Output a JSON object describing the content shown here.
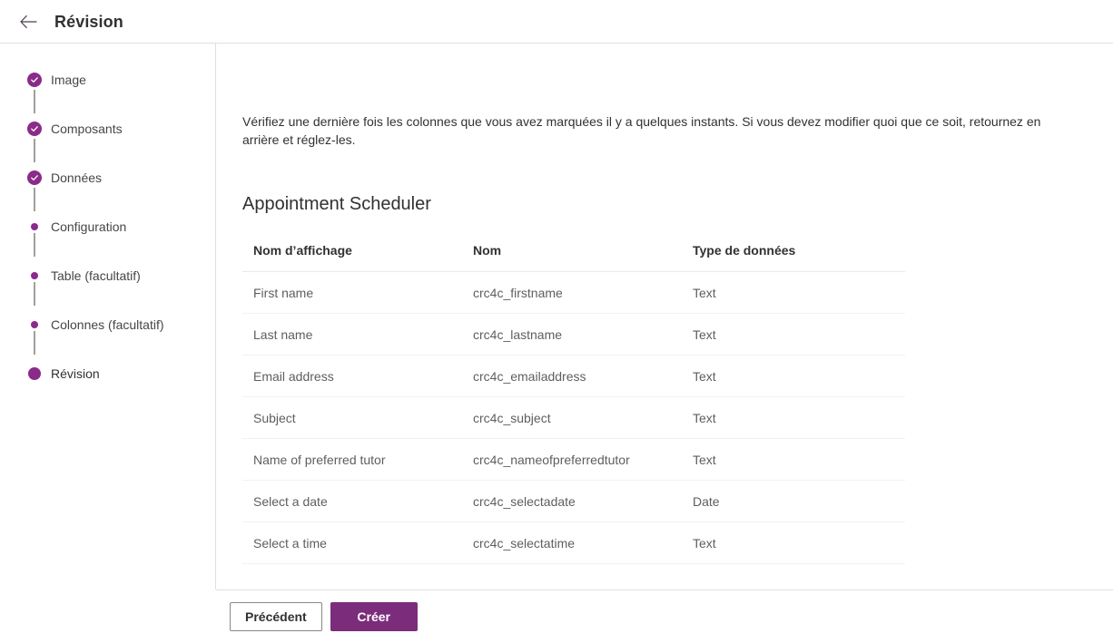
{
  "header": {
    "back_icon": "arrow-left-icon",
    "title": "Révision"
  },
  "sidebar": {
    "steps": [
      {
        "label": "Image",
        "state": "done"
      },
      {
        "label": "Composants",
        "state": "done"
      },
      {
        "label": "Données",
        "state": "done"
      },
      {
        "label": "Configuration",
        "state": "pending"
      },
      {
        "label": "Table (facultatif)",
        "state": "pending"
      },
      {
        "label": "Colonnes (facultatif)",
        "state": "pending"
      },
      {
        "label": "Révision",
        "state": "current"
      }
    ]
  },
  "main": {
    "description": "Vérifiez une dernière fois les colonnes que vous avez marquées il y a quelques instants. Si vous devez modifier quoi que ce soit, retournez en arrière et réglez-les.",
    "section_title": "Appointment Scheduler",
    "table": {
      "columns": [
        "Nom d’affichage",
        "Nom",
        "Type de données"
      ],
      "rows": [
        [
          "First name",
          "crc4c_firstname",
          "Text"
        ],
        [
          "Last name",
          "crc4c_lastname",
          "Text"
        ],
        [
          "Email address",
          "crc4c_emailaddress",
          "Text"
        ],
        [
          "Subject",
          "crc4c_subject",
          "Text"
        ],
        [
          "Name of preferred tutor",
          "crc4c_nameofpreferredtutor",
          "Text"
        ],
        [
          "Select a date",
          "crc4c_selectadate",
          "Date"
        ],
        [
          "Select a time",
          "crc4c_selectatime",
          "Text"
        ]
      ]
    }
  },
  "footer": {
    "back_label": "Précédent",
    "create_label": "Créer"
  },
  "colors": {
    "accent": "#7b2d7b",
    "marker": "#8a2b8a",
    "text_primary": "#323130",
    "text_secondary": "#605e5c",
    "divider": "#e1dfdd"
  }
}
